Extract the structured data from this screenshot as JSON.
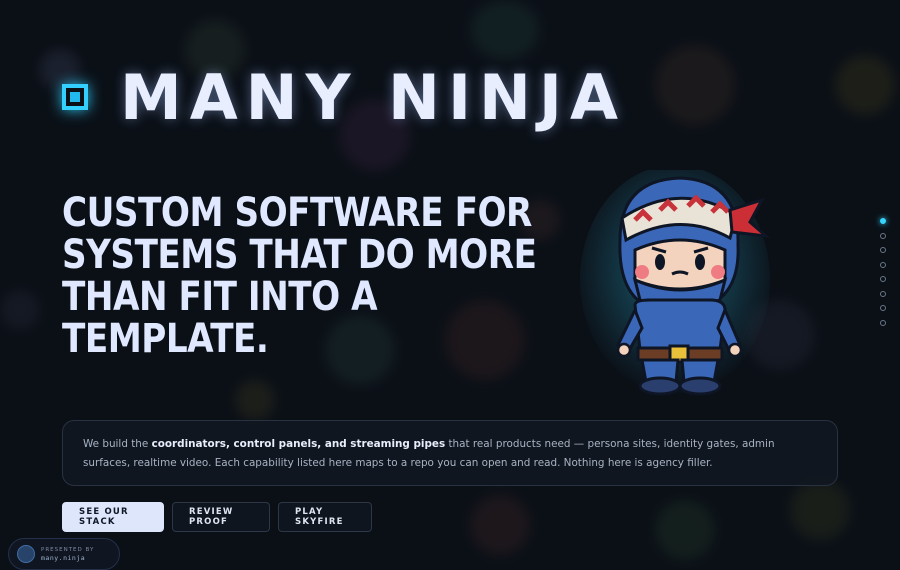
{
  "brand": {
    "title": "MANY NINJA",
    "accent": "#33d0ff"
  },
  "hero": {
    "headline_lines": [
      "CUSTOM SOFTWARE FOR",
      "SYSTEMS THAT DO MORE",
      "THAN FIT INTO A",
      "TEMPLATE."
    ]
  },
  "intro": {
    "before": "We build the ",
    "emphasis": "coordinators, control panels, and streaming pipes",
    "after": " that real products need — persona sites, identity gates, admin surfaces, realtime video. Each capability listed here maps to a repo you can open and read. Nothing here is agency filler."
  },
  "buttons": {
    "stack": "SEE OUR STACK",
    "proof": "REVIEW PROOF",
    "skyfire": "PLAY SKYFIRE"
  },
  "pager": {
    "count": 8,
    "active_index": 0
  },
  "badge": {
    "line1": "PRESENTED BY",
    "line2": "many.ninja"
  },
  "icons": {
    "brand": "square-logo-icon",
    "mascot": "ninja-mascot-illustration",
    "avatar": "ninja-avatar-icon"
  }
}
